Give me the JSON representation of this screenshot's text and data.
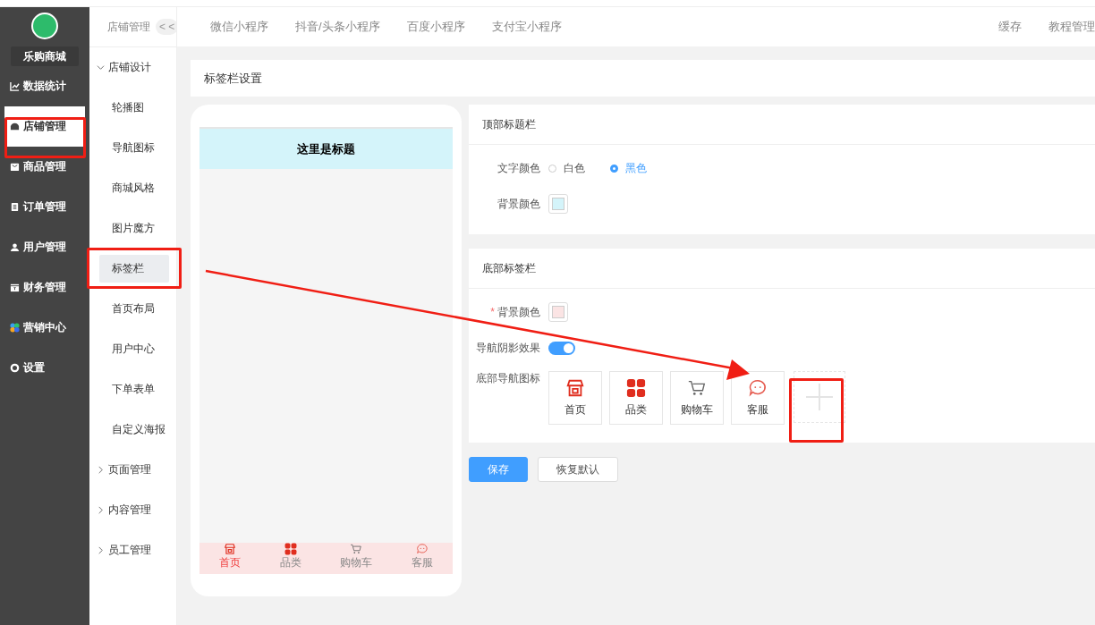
{
  "brand": {
    "name": "乐购商城"
  },
  "main_menu": [
    {
      "label": "数据统计",
      "kind": "chart",
      "selected": false
    },
    {
      "label": "店铺管理",
      "kind": "home",
      "selected": true
    },
    {
      "label": "商品管理",
      "kind": "bag",
      "selected": false
    },
    {
      "label": "订单管理",
      "kind": "clipboard",
      "selected": false
    },
    {
      "label": "用户管理",
      "kind": "user",
      "selected": false
    },
    {
      "label": "财务管理",
      "kind": "wallet",
      "selected": false
    },
    {
      "label": "营销中心",
      "kind": "marketing",
      "selected": false
    },
    {
      "label": "设置",
      "kind": "gear",
      "selected": false
    }
  ],
  "sub_menu": {
    "title": "店铺管理",
    "collapse_button": "< <",
    "groups": [
      {
        "label": "店铺设计",
        "expanded": true,
        "children": [
          {
            "label": "轮播图",
            "selected": false
          },
          {
            "label": "导航图标",
            "selected": false
          },
          {
            "label": "商城风格",
            "selected": false
          },
          {
            "label": "图片魔方",
            "selected": false
          },
          {
            "label": "标签栏",
            "selected": true
          },
          {
            "label": "首页布局",
            "selected": false
          },
          {
            "label": "用户中心",
            "selected": false
          },
          {
            "label": "下单表单",
            "selected": false
          },
          {
            "label": "自定义海报",
            "selected": false
          }
        ]
      },
      {
        "label": "页面管理",
        "expanded": false
      },
      {
        "label": "内容管理",
        "expanded": false
      },
      {
        "label": "员工管理",
        "expanded": false
      }
    ]
  },
  "top_tabs": [
    "微信小程序",
    "抖音/头条小程序",
    "百度小程序",
    "支付宝小程序"
  ],
  "top_right": [
    "缓存",
    "教程管理"
  ],
  "panel_title": "标签栏设置",
  "preview": {
    "title": "这里是标题",
    "tabbar": [
      {
        "label": "首页",
        "kind": "store",
        "selected": true
      },
      {
        "label": "品类",
        "kind": "grid",
        "selected": false
      },
      {
        "label": "购物车",
        "kind": "cart",
        "selected": false
      },
      {
        "label": "客服",
        "kind": "chat",
        "selected": false
      }
    ]
  },
  "top_bar_section": {
    "heading": "顶部标题栏",
    "text_color_label": "文字颜色",
    "options": [
      {
        "label": "白色",
        "selected": false
      },
      {
        "label": "黑色",
        "selected": true
      }
    ],
    "bg_label": "背景颜色",
    "bg_swatch": {
      "color": "#d4f4fa"
    }
  },
  "bottom_section": {
    "heading": "底部标签栏",
    "bg_label": "背景颜色",
    "required_mark": "*",
    "bg_swatch": {
      "color": "#fbe4e4"
    },
    "shadow_label": "导航阴影效果",
    "shadow_on": true,
    "icons_label": "底部导航图标",
    "icons": [
      {
        "label": "首页",
        "kind": "store"
      },
      {
        "label": "品类",
        "kind": "grid"
      },
      {
        "label": "购物车",
        "kind": "cart"
      },
      {
        "label": "客服",
        "kind": "chat"
      }
    ]
  },
  "buttons": [
    {
      "label": "保存",
      "kind": "primary"
    },
    {
      "label": "恢复默认",
      "kind": "default"
    }
  ]
}
